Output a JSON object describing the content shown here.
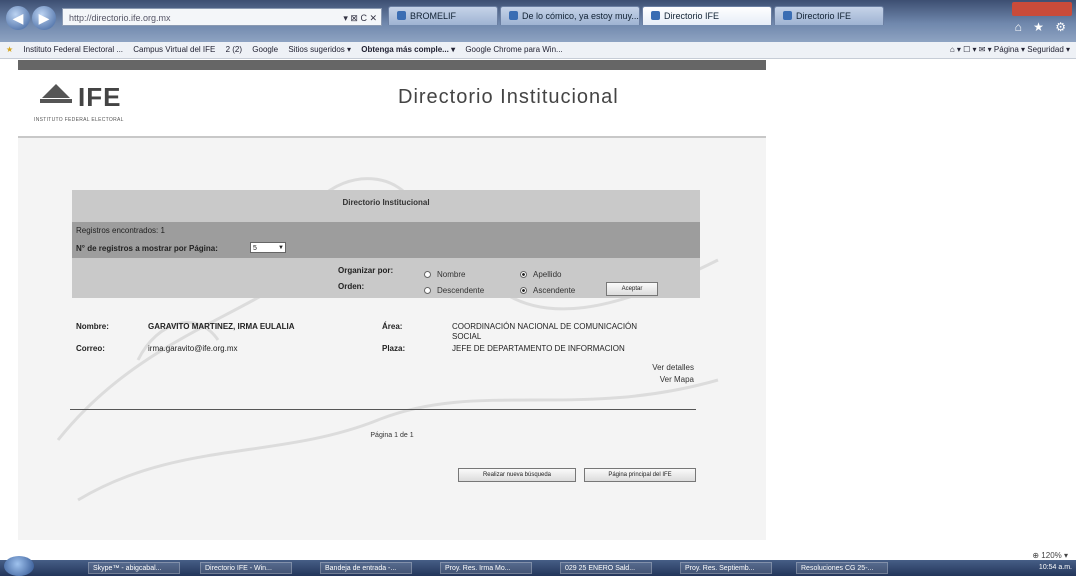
{
  "browser": {
    "address": "http://directorio.ife.org.mx",
    "address_controls": "▾ ⊠ C ✕",
    "tabs": [
      {
        "label": "BROMELIF",
        "active": false
      },
      {
        "label": "De lo cómico, ya estoy muy...",
        "active": false
      },
      {
        "label": "Directorio IFE",
        "active": true
      },
      {
        "label": "Directorio IFE",
        "active": false
      }
    ],
    "right_icons": "⌂ ★ ⚙"
  },
  "favorites": {
    "items": [
      "Instituto Federal Electoral ...",
      "Campus Virtual del IFE",
      "2 (2)",
      "Google",
      "Sitios sugeridos ▾",
      "Obtenga más comple... ▾",
      "Google Chrome para Win..."
    ],
    "tools": "⌂ ▾  ☐ ▾  ✉ ▾  Página ▾  Seguridad ▾"
  },
  "header": {
    "logo_text": "IFE",
    "logo_subtitle": "INSTITUTO FEDERAL ELECTORAL",
    "title": "Directorio Institucional"
  },
  "search_panel": {
    "title": "Directorio Institucional",
    "records_found": "Registros encontrados: 1",
    "per_page_label": "N° de registros a mostrar por Página:",
    "per_page_value": "5",
    "organize_label": "Organizar por:",
    "order_label": "Orden:",
    "options": {
      "nombre": "Nombre",
      "apellido": "Apellido",
      "descendente": "Descendente",
      "ascendente": "Ascendente"
    },
    "accept_label": "Aceptar"
  },
  "result": {
    "nombre_label": "Nombre:",
    "nombre_value": "GARAVITO MARTINEZ, IRMA EULALIA",
    "correo_label": "Correo:",
    "correo_value": "irma.garavito@ife.org.mx",
    "area_label": "Área:",
    "area_value_1": "COORDINACIÓN NACIONAL DE COMUNICACIÓN",
    "area_value_2": "SOCIAL",
    "plaza_label": "Plaza:",
    "plaza_value": "JEFE DE DEPARTAMENTO DE INFORMACION",
    "details_link": "Ver detalles",
    "map_link": "Ver Mapa"
  },
  "pager": {
    "text": "Página 1 de 1"
  },
  "actions": {
    "new_search": "Realizar nueva búsqueda",
    "home": "Página principal del IFE"
  },
  "status": {
    "zoom": "⊕ 120% ▾"
  },
  "taskbar": {
    "items": [
      "Skype™ - abigcabal...",
      "Directorio IFE - Win...",
      "Bandeja de entrada -...",
      "Proy. Res. Irma Mo...",
      "029 25 ENERO Sald...",
      "Proy. Res. Septiemb...",
      "Resoluciones CG 25-..."
    ],
    "clock": "10:54 a.m."
  }
}
